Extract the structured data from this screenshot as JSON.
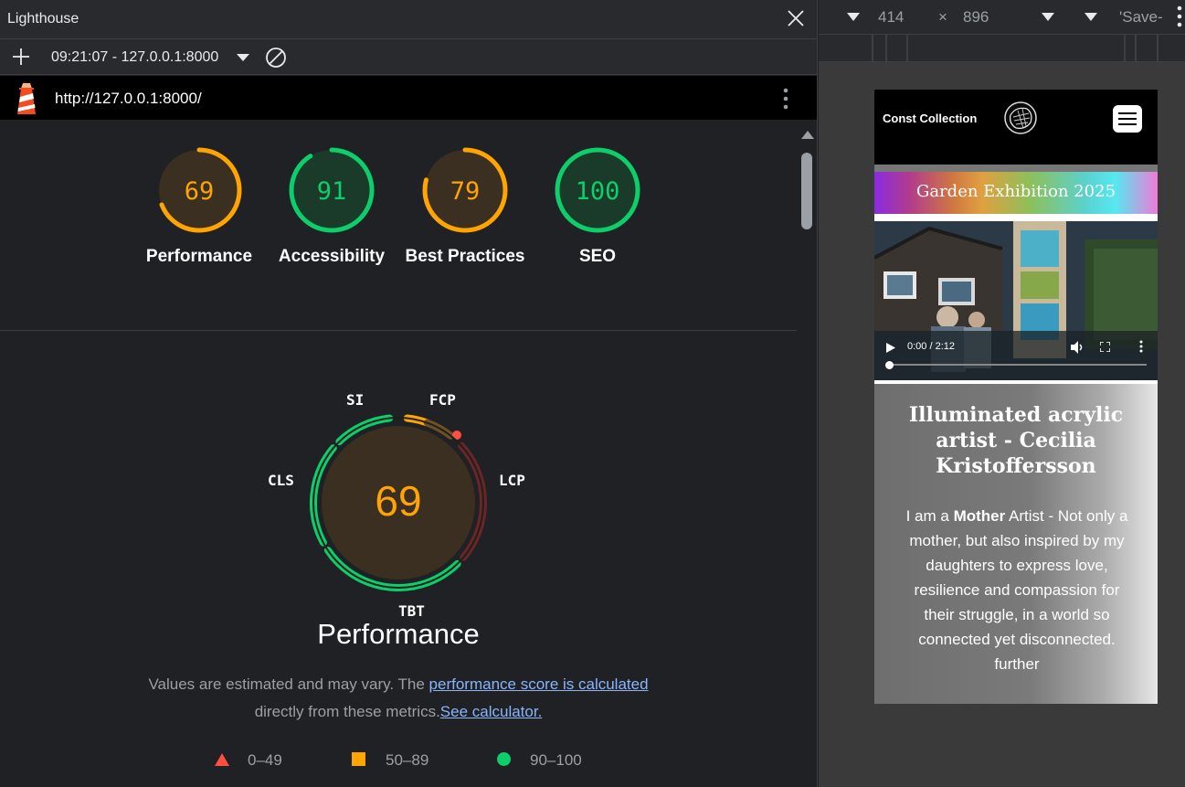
{
  "lighthouse": {
    "title": "Lighthouse",
    "report_selector": "09:21:07 - 127.0.0.1:8000",
    "url": "http://127.0.0.1:8000/",
    "categories": [
      {
        "score": "69",
        "label": "Performance",
        "value": 69,
        "color": "#ffa400"
      },
      {
        "score": "91",
        "label": "Accessibility",
        "value": 91,
        "color": "#0cce6b"
      },
      {
        "score": "79",
        "label": "Best Practices",
        "value": 79,
        "color": "#ffa400"
      },
      {
        "score": "100",
        "label": "SEO",
        "value": 100,
        "color": "#0cce6b"
      }
    ],
    "performance": {
      "score": "69",
      "title": "Performance",
      "metrics": [
        "SI",
        "FCP",
        "LCP",
        "TBT",
        "CLS"
      ],
      "note_prefix": "Values are estimated and may vary. The",
      "note_link": "performance score is calculated",
      "note_line2": "directly from these metrics.",
      "calculator_link": "See calculator."
    },
    "legend": [
      {
        "label": "0–49",
        "color": "#ff4e42",
        "icon": "triangle-icon"
      },
      {
        "label": "50–89",
        "color": "#ffa400",
        "icon": "square-icon"
      },
      {
        "label": "90–100",
        "color": "#0cce6b",
        "icon": "circle-icon"
      }
    ]
  },
  "device_toolbar": {
    "width": "414",
    "times": "×",
    "height": "896",
    "throttle": "'Save-"
  },
  "mobile_page": {
    "brand": "Const Collection",
    "banner": "Garden Exhibition 2025",
    "video_time": "0:00 / 2:12",
    "heading": "Illuminated acrylic artist - Cecilia Kristoffersson",
    "intro_before": "I am a",
    "intro_bold": "Mother",
    "intro_after": "Artist - Not only a mother, but also inspired by my daughters to express love, resilience and compassion for their struggle, in a world so connected yet disconnected. further"
  }
}
